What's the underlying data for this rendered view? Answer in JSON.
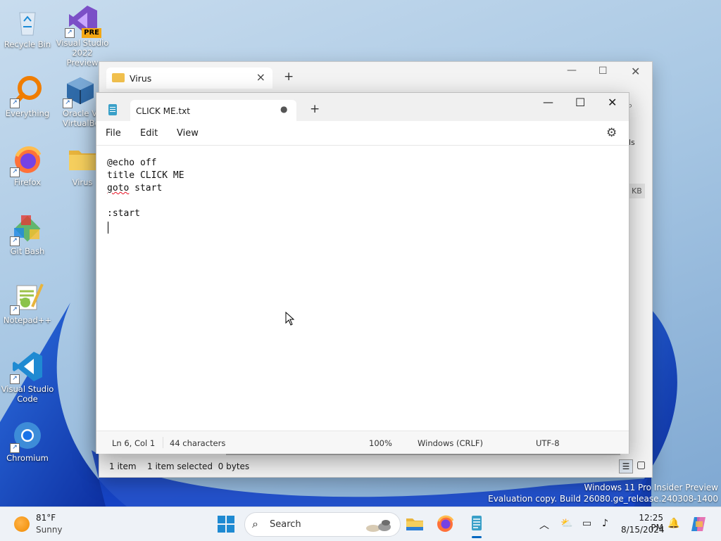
{
  "desktop": {
    "icons": [
      {
        "label": "Recycle Bin"
      },
      {
        "label": "Visual Studio 2022 Preview",
        "badge": "PRE"
      },
      {
        "label": "Everything"
      },
      {
        "label": "Oracle VM VirtualBox",
        "visible_label": "Oracle Vi VirtualBo"
      },
      {
        "label": "Firefox"
      },
      {
        "label": "Virus"
      },
      {
        "label": "Git Bash"
      },
      {
        "label": "Notepad++"
      },
      {
        "label": "Visual Studio Code"
      },
      {
        "label": "Chromium"
      }
    ]
  },
  "explorer": {
    "tab_title": "Virus",
    "partial_text_1": "ls",
    "partial_text_2": "KB",
    "status_items": "1 item",
    "status_selected": "1 item selected  0 bytes"
  },
  "notepad": {
    "tab_title": "CLICK ME.txt",
    "unsaved_indicator": "●",
    "menu": {
      "file": "File",
      "edit": "Edit",
      "view": "View"
    },
    "content_lines": [
      "@echo off",
      "title CLICK ME",
      "goto start",
      "",
      ":start"
    ],
    "status": {
      "position": "Ln 6, Col 1",
      "characters": "44 characters",
      "zoom": "100%",
      "line_ending": "Windows (CRLF)",
      "encoding": "UTF-8"
    }
  },
  "watermark": {
    "line1": "Windows 11 Pro Insider Preview",
    "line2": "Evaluation copy. Build 26080.ge_release.240308-1400"
  },
  "taskbar": {
    "weather_temp": "81°F",
    "weather_condition": "Sunny",
    "search_placeholder": "Search",
    "clock_time": "12:25 PM",
    "clock_date": "8/15/2024"
  },
  "colors": {
    "accent": "#0067c0",
    "folder": "#f2c14e",
    "spellcheck": "#e81123"
  }
}
